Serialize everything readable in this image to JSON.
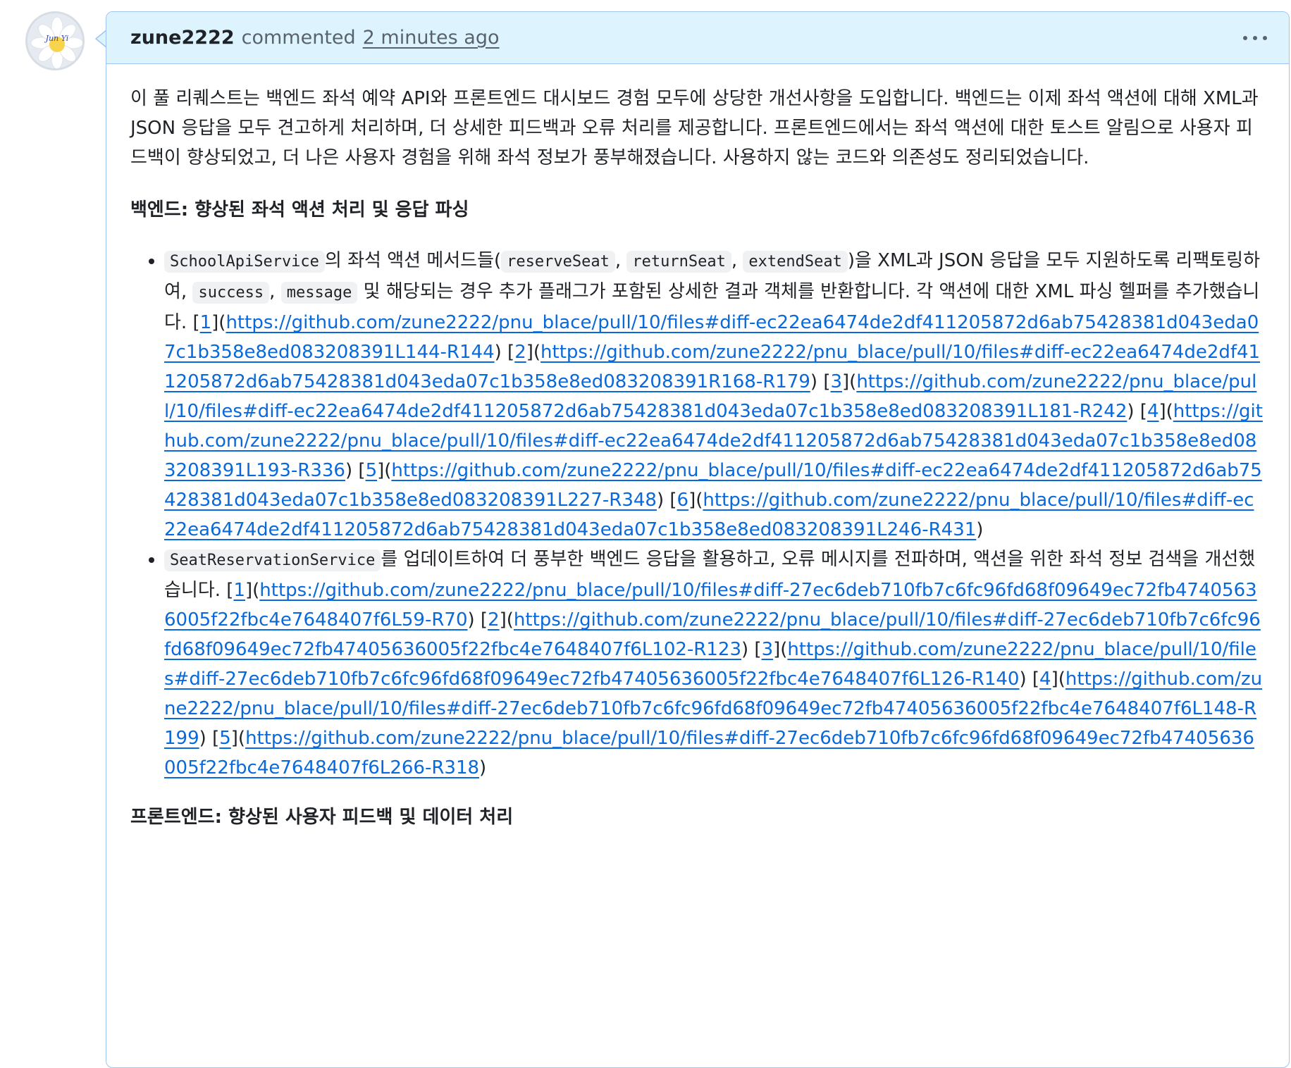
{
  "avatar": {
    "text": "Jun Yi",
    "accent": "#f7d44c"
  },
  "header": {
    "author": "zune2222",
    "verb": "commented",
    "time": "2 minutes ago",
    "menu_icon": "kebab-horizontal-icon"
  },
  "body": {
    "intro": "이 풀 리퀘스트는 백엔드 좌석 예약 API와 프론트엔드 대시보드 경험 모두에 상당한 개선사항을 도입합니다. 백엔드는 이제 좌석 액션에 대해 XML과 JSON 응답을 모두 견고하게 처리하며, 더 상세한 피드백과 오류 처리를 제공합니다. 프론트엔드에서는 좌석 액션에 대한 토스트 알림으로 사용자 피드백이 향상되었고, 더 나은 사용자 경험을 위해 좌석 정보가 풍부해졌습니다. 사용하지 않는 코드와 의존성도 정리되었습니다.",
    "section1_title": "백엔드: 향상된 좌석 액션 처리 및 응답 파싱",
    "item1": {
      "code1": "SchoolApiService",
      "t1": "의 좌석 액션 메서드들(",
      "code2": "reserveSeat",
      "sep1": ", ",
      "code3": "returnSeat",
      "sep2": ", ",
      "code4": "extendSeat",
      "t2": ")을 XML과 JSON 응답을 모두 지원하도록 리팩토링하여, ",
      "code5": "success",
      "sep3": ", ",
      "code6": "message",
      "t3": " 및 해당되는 경우 추가 플래그가 포함된 상세한 결과 객체를 반환합니다. 각 액션에 대한 XML 파싱 헬퍼를 추가했습니다. ",
      "refs": [
        {
          "label": "1",
          "url": "https://github.com/zune2222/pnu_blace/pull/10/files#diff-ec22ea6474de2df411205872d6ab75428381d043eda07c1b358e8ed083208391L144-R144"
        },
        {
          "label": "2",
          "url": "https://github.com/zune2222/pnu_blace/pull/10/files#diff-ec22ea6474de2df411205872d6ab75428381d043eda07c1b358e8ed083208391R168-R179"
        },
        {
          "label": "3",
          "url": "https://github.com/zune2222/pnu_blace/pull/10/files#diff-ec22ea6474de2df411205872d6ab75428381d043eda07c1b358e8ed083208391L181-R242"
        },
        {
          "label": "4",
          "url": "https://github.com/zune2222/pnu_blace/pull/10/files#diff-ec22ea6474de2df411205872d6ab75428381d043eda07c1b358e8ed083208391L193-R336"
        },
        {
          "label": "5",
          "url": "https://github.com/zune2222/pnu_blace/pull/10/files#diff-ec22ea6474de2df411205872d6ab75428381d043eda07c1b358e8ed083208391L227-R348"
        },
        {
          "label": "6",
          "url": "https://github.com/zune2222/pnu_blace/pull/10/files#diff-ec22ea6474de2df411205872d6ab75428381d043eda07c1b358e8ed083208391L246-R431"
        }
      ]
    },
    "item2": {
      "code1": "SeatReservationService",
      "t1": "를 업데이트하여 더 풍부한 백엔드 응답을 활용하고, 오류 메시지를 전파하며, 액션을 위한 좌석 정보 검색을 개선했습니다. ",
      "refs": [
        {
          "label": "1",
          "url": "https://github.com/zune2222/pnu_blace/pull/10/files#diff-27ec6deb710fb7c6fc96fd68f09649ec72fb47405636005f22fbc4e7648407f6L59-R70"
        },
        {
          "label": "2",
          "url": "https://github.com/zune2222/pnu_blace/pull/10/files#diff-27ec6deb710fb7c6fc96fd68f09649ec72fb47405636005f22fbc4e7648407f6L102-R123"
        },
        {
          "label": "3",
          "url": "https://github.com/zune2222/pnu_blace/pull/10/files#diff-27ec6deb710fb7c6fc96fd68f09649ec72fb47405636005f22fbc4e7648407f6L126-R140"
        },
        {
          "label": "4",
          "url": "https://github.com/zune2222/pnu_blace/pull/10/files#diff-27ec6deb710fb7c6fc96fd68f09649ec72fb47405636005f22fbc4e7648407f6L148-R199"
        },
        {
          "label": "5",
          "url": "https://github.com/zune2222/pnu_blace/pull/10/files#diff-27ec6deb710fb7c6fc96fd68f09649ec72fb47405636005f22fbc4e7648407f6L266-R318"
        }
      ]
    },
    "section2_title": "프론트엔드: 향상된 사용자 피드백 및 데이터 처리"
  }
}
